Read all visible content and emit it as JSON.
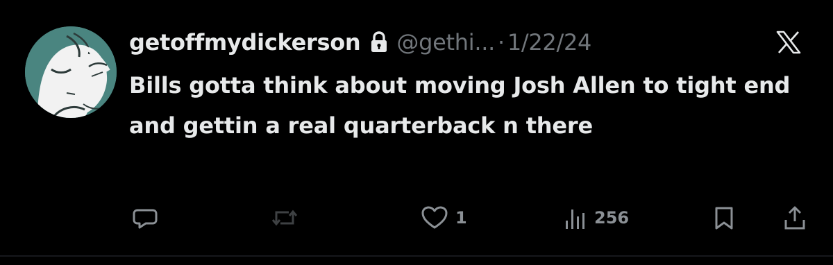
{
  "tweet": {
    "display_name": "getoffmydickerson",
    "handle": "@gethi...",
    "separator": "·",
    "date": "1/22/24",
    "text": "Bills gotta think about moving Josh Allen to tight end and gettin a real quarterback n there"
  },
  "icons": {
    "lock": "lock-icon",
    "platform": "x-logo-icon",
    "reply": "speech-bubble-icon",
    "retweet": "retweet-icon",
    "like": "heart-icon",
    "views": "bar-chart-icon",
    "bookmark": "bookmark-icon",
    "share": "share-icon"
  },
  "actions": {
    "like_count": "1",
    "views_count": "256"
  },
  "colors": {
    "background": "#000000",
    "primary_text": "#e7e9ea",
    "secondary_text": "#71767b",
    "avatar_background": "#4a8580"
  }
}
